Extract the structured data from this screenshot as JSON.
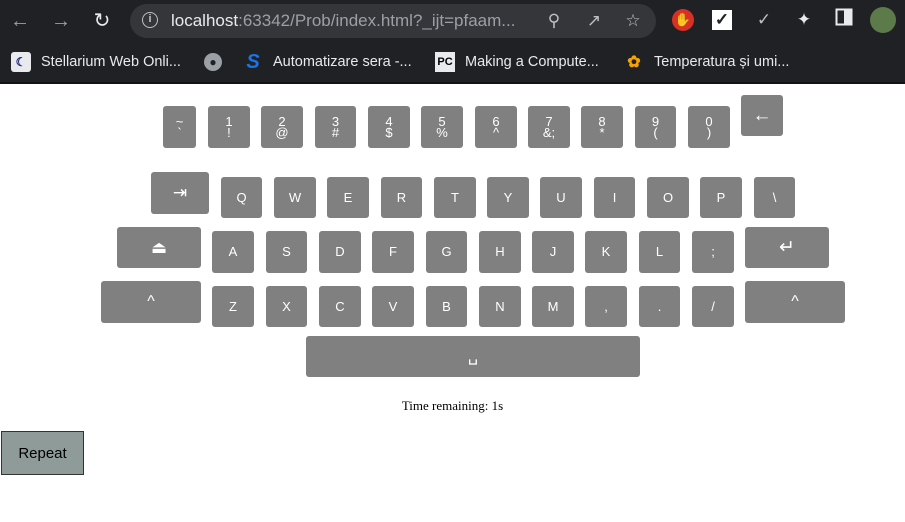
{
  "browser": {
    "url_host": "localhost",
    "url_rest": ":63342/Prob/index.html?_ijt=pfaam...",
    "bookmarks": [
      {
        "label": "Stellarium Web Onli...",
        "icon": "stellarium-icon"
      },
      {
        "label": "",
        "icon": "globe-icon"
      },
      {
        "label": "Automatizare sera -...",
        "icon": "s-logo-icon"
      },
      {
        "label": "Making a Compute...",
        "icon": "pycharm-icon"
      },
      {
        "label": "Temperatura și umi...",
        "icon": "butterfly-icon"
      }
    ]
  },
  "keyboard": {
    "row1": [
      {
        "top": "~",
        "bottom": "`"
      },
      {
        "top": "1",
        "bottom": "!"
      },
      {
        "top": "2",
        "bottom": "@"
      },
      {
        "top": "3",
        "bottom": "#"
      },
      {
        "top": "4",
        "bottom": "$"
      },
      {
        "top": "5",
        "bottom": "%"
      },
      {
        "top": "6",
        "bottom": "^"
      },
      {
        "top": "7",
        "bottom": "&;"
      },
      {
        "top": "8",
        "bottom": "*"
      },
      {
        "top": "9",
        "bottom": "("
      },
      {
        "top": "0",
        "bottom": ")"
      }
    ],
    "backspace": "←",
    "tab": "⇥",
    "row2": [
      "Q",
      "W",
      "E",
      "R",
      "T",
      "Y",
      "U",
      "I",
      "O",
      "P",
      "\\"
    ],
    "capslock": "⏏",
    "row3": [
      "A",
      "S",
      "D",
      "F",
      "G",
      "H",
      "J",
      "K",
      "L",
      ";"
    ],
    "enter": "↵",
    "shift_left": "^",
    "row4": [
      "Z",
      "X",
      "C",
      "V",
      "B",
      "N",
      "M",
      ",",
      ".",
      "/"
    ],
    "shift_right": "^",
    "space": "␣"
  },
  "status": "Time remaining: 1s",
  "repeat_label": "Repeat"
}
